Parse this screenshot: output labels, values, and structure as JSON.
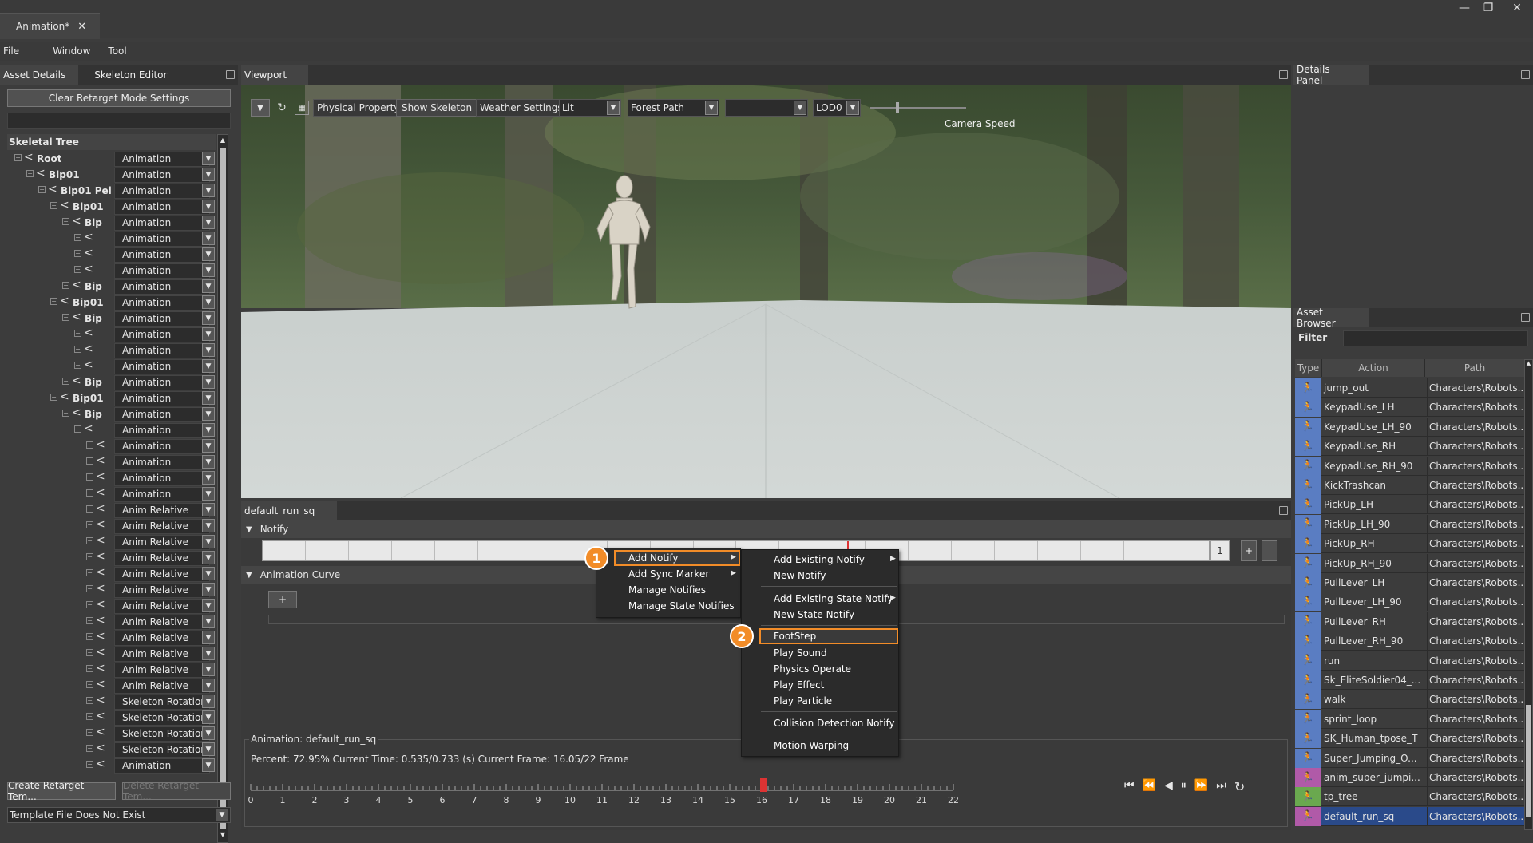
{
  "window": {
    "tab_title": "Animation*",
    "close_glyph": "✕",
    "min_glyph": "—",
    "max_glyph": "❐",
    "close_win_glyph": "✕"
  },
  "menubar": [
    "File",
    "Window",
    "Tool"
  ],
  "left_panel": {
    "tabs": [
      "Asset Details",
      "Skeleton Editor"
    ],
    "clear_button": "Clear Retarget Mode Settings",
    "tree_header": "Skeletal Tree",
    "tree": [
      {
        "name": "Root",
        "type": "Animation",
        "indent": 0
      },
      {
        "name": "Bip01",
        "type": "Animation",
        "indent": 1
      },
      {
        "name": "Bip01 Pel",
        "type": "Animation",
        "indent": 2
      },
      {
        "name": "Bip01",
        "type": "Animation",
        "indent": 3
      },
      {
        "name": "Bip",
        "type": "Animation",
        "indent": 4
      },
      {
        "name": "",
        "type": "Animation",
        "indent": 5
      },
      {
        "name": "",
        "type": "Animation",
        "indent": 5
      },
      {
        "name": "",
        "type": "Animation",
        "indent": 5
      },
      {
        "name": "Bip",
        "type": "Animation",
        "indent": 4
      },
      {
        "name": "Bip01",
        "type": "Animation",
        "indent": 3
      },
      {
        "name": "Bip",
        "type": "Animation",
        "indent": 4
      },
      {
        "name": "",
        "type": "Animation",
        "indent": 5
      },
      {
        "name": "",
        "type": "Animation",
        "indent": 5
      },
      {
        "name": "",
        "type": "Animation",
        "indent": 5
      },
      {
        "name": "Bip",
        "type": "Animation",
        "indent": 4
      },
      {
        "name": "Bip01",
        "type": "Animation",
        "indent": 3
      },
      {
        "name": "Bip",
        "type": "Animation",
        "indent": 4
      },
      {
        "name": "",
        "type": "Animation",
        "indent": 5
      },
      {
        "name": "",
        "type": "Animation",
        "indent": 6
      },
      {
        "name": "",
        "type": "Animation",
        "indent": 6
      },
      {
        "name": "",
        "type": "Animation",
        "indent": 6
      },
      {
        "name": "",
        "type": "Animation",
        "indent": 6
      },
      {
        "name": "",
        "type": "Anim Relative",
        "indent": 6
      },
      {
        "name": "",
        "type": "Anim Relative",
        "indent": 6
      },
      {
        "name": "",
        "type": "Anim Relative",
        "indent": 6
      },
      {
        "name": "",
        "type": "Anim Relative",
        "indent": 6
      },
      {
        "name": "",
        "type": "Anim Relative",
        "indent": 6
      },
      {
        "name": "",
        "type": "Anim Relative",
        "indent": 6
      },
      {
        "name": "",
        "type": "Anim Relative",
        "indent": 6
      },
      {
        "name": "",
        "type": "Anim Relative",
        "indent": 6
      },
      {
        "name": "",
        "type": "Anim Relative",
        "indent": 6
      },
      {
        "name": "",
        "type": "Anim Relative",
        "indent": 6
      },
      {
        "name": "",
        "type": "Anim Relative",
        "indent": 6
      },
      {
        "name": "",
        "type": "Anim Relative",
        "indent": 6
      },
      {
        "name": "",
        "type": "Skeleton Rotation",
        "indent": 6
      },
      {
        "name": "",
        "type": "Skeleton Rotation",
        "indent": 6
      },
      {
        "name": "",
        "type": "Skeleton Rotation",
        "indent": 6
      },
      {
        "name": "",
        "type": "Skeleton Rotation",
        "indent": 6
      },
      {
        "name": "",
        "type": "Animation",
        "indent": 6
      }
    ],
    "create_template": "Create Retarget Tem...",
    "delete_template": "Delete Retarget Tem...",
    "template_status": "Template File Does Not Exist"
  },
  "viewport": {
    "tab": "Viewport",
    "physical_property": "Physical Property",
    "show_skeleton": "Show Skeleton",
    "weather_settings": "Weather Settings",
    "lit_value": "Lit",
    "scene_value": "Forest Path",
    "empty_value": "",
    "lod_value": "LOD0",
    "camera_speed": "Camera Speed"
  },
  "anim_panel": {
    "tab": "default_run_sq",
    "notify_header": "Notify",
    "curve_header": "Animation Curve",
    "add_glyph": "+",
    "track_index": "1",
    "group_label": "Animation: default_run_sq",
    "status_text": "Percent: 72.95% Current Time: 0.535/0.733 (s) Current Frame: 16.05/22 Frame",
    "ruler": [
      "0",
      "1",
      "2",
      "3",
      "4",
      "5",
      "6",
      "7",
      "8",
      "9",
      "10",
      "11",
      "12",
      "13",
      "14",
      "15",
      "16",
      "17",
      "18",
      "19",
      "20",
      "21",
      "22"
    ],
    "current_frame": 16.05,
    "total_frames": 22
  },
  "context_menu_1": {
    "items": [
      "Add Notify",
      "Add Sync Marker",
      "Manage Notifies",
      "Manage State Notifies"
    ],
    "badge": "1"
  },
  "context_menu_2": {
    "items": [
      "Add Existing Notify",
      "New Notify",
      "Add Existing State Notify",
      "New State Notify",
      "FootStep",
      "Play Sound",
      "Physics Operate",
      "Play Effect",
      "Play Particle",
      "Collision Detection Notify",
      "Motion Warping"
    ],
    "badge": "2"
  },
  "details_panel": {
    "tab": "Details Panel"
  },
  "asset_browser": {
    "tab": "Asset Browser",
    "filter_label": "Filter",
    "filter_value": "",
    "columns": [
      "Type",
      "Action",
      "Path"
    ],
    "rows": [
      {
        "name": "jump_out",
        "path": "Characters\\Robots...",
        "color": "#5a7dc2"
      },
      {
        "name": "KeypadUse_LH",
        "path": "Characters\\Robots...",
        "color": "#5a7dc2"
      },
      {
        "name": "KeypadUse_LH_90",
        "path": "Characters\\Robots...",
        "color": "#5a7dc2"
      },
      {
        "name": "KeypadUse_RH",
        "path": "Characters\\Robots...",
        "color": "#5a7dc2"
      },
      {
        "name": "KeypadUse_RH_90",
        "path": "Characters\\Robots...",
        "color": "#5a7dc2"
      },
      {
        "name": "KickTrashcan",
        "path": "Characters\\Robots...",
        "color": "#5a7dc2"
      },
      {
        "name": "PickUp_LH",
        "path": "Characters\\Robots...",
        "color": "#5a7dc2"
      },
      {
        "name": "PickUp_LH_90",
        "path": "Characters\\Robots...",
        "color": "#5a7dc2"
      },
      {
        "name": "PickUp_RH",
        "path": "Characters\\Robots...",
        "color": "#5a7dc2"
      },
      {
        "name": "PickUp_RH_90",
        "path": "Characters\\Robots...",
        "color": "#5a7dc2"
      },
      {
        "name": "PullLever_LH",
        "path": "Characters\\Robots...",
        "color": "#5a7dc2"
      },
      {
        "name": "PullLever_LH_90",
        "path": "Characters\\Robots...",
        "color": "#5a7dc2"
      },
      {
        "name": "PullLever_RH",
        "path": "Characters\\Robots...",
        "color": "#5a7dc2"
      },
      {
        "name": "PullLever_RH_90",
        "path": "Characters\\Robots...",
        "color": "#5a7dc2"
      },
      {
        "name": "run",
        "path": "Characters\\Robots...",
        "color": "#5a7dc2"
      },
      {
        "name": "Sk_EliteSoldier04_...",
        "path": "Characters\\Robots...",
        "color": "#5a7dc2"
      },
      {
        "name": "walk",
        "path": "Characters\\Robots...",
        "color": "#5a7dc2"
      },
      {
        "name": "sprint_loop",
        "path": "Characters\\Robots...",
        "color": "#5a7dc2"
      },
      {
        "name": "SK_Human_tpose_T",
        "path": "Characters\\Robots...",
        "color": "#5a7dc2"
      },
      {
        "name": "Super_Jumping_O...",
        "path": "Characters\\Robots...",
        "color": "#5a7dc2"
      },
      {
        "name": "anim_super_jumpi...",
        "path": "Characters\\Robots...",
        "color": "#b05aa8"
      },
      {
        "name": "tp_tree",
        "path": "Characters\\Robots...",
        "color": "#6aa84f"
      },
      {
        "name": "default_run_sq",
        "path": "Characters\\Robots...",
        "color": "#b05aa8"
      }
    ],
    "selected_index": 22
  },
  "playback": {
    "icons": [
      "skip-start-icon",
      "step-back-icon",
      "play-back-icon",
      "pause-icon",
      "step-forward-icon",
      "skip-end-icon",
      "loop-icon"
    ],
    "glyphs": [
      "⏮",
      "⏪",
      "◀",
      "⏸",
      "⏩",
      "⏭",
      "↻"
    ]
  }
}
